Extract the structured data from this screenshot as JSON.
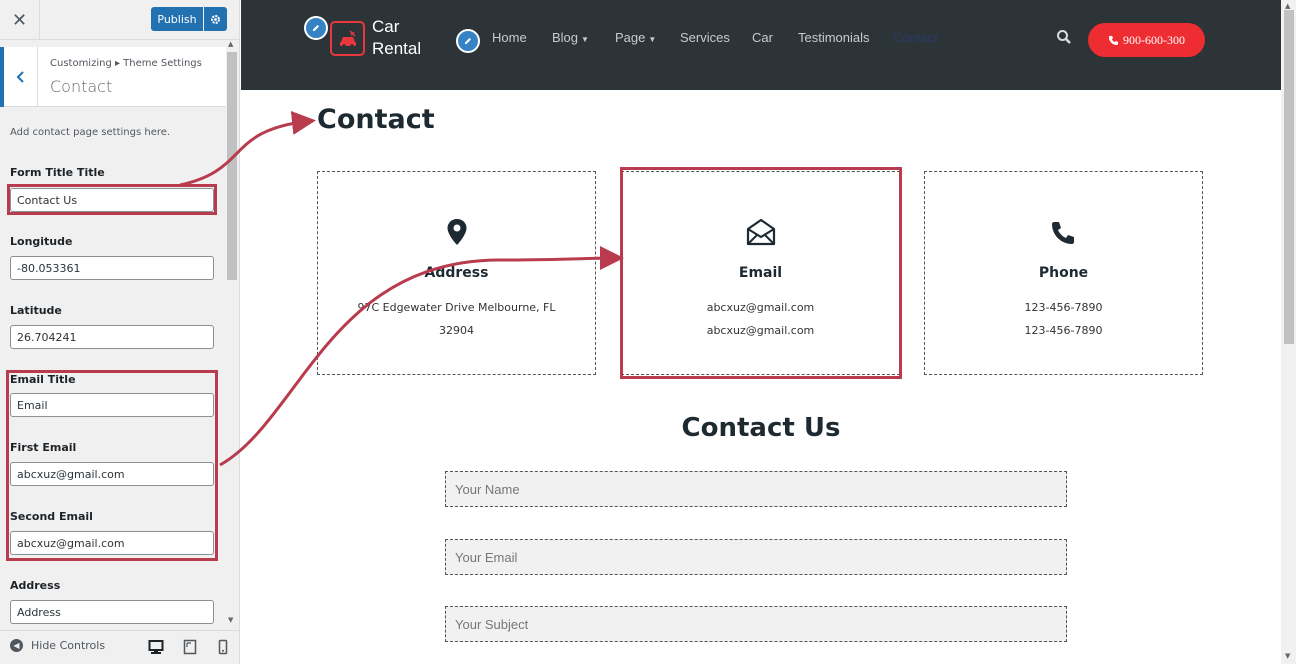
{
  "customizer": {
    "close_label": "✕",
    "publish_label": "Publish",
    "breadcrumb": "Customizing ▸ Theme Settings",
    "section_title": "Contact",
    "description": "Add contact page settings here.",
    "fields": {
      "form_title": {
        "label": "Form Title Title",
        "value": "Contact Us"
      },
      "longitude": {
        "label": "Longitude",
        "value": "-80.053361"
      },
      "latitude": {
        "label": "Latitude",
        "value": "26.704241"
      },
      "email_title": {
        "label": "Email Title",
        "value": "Email"
      },
      "first_email": {
        "label": "First Email",
        "value": "abcxuz@gmail.com"
      },
      "second_email": {
        "label": "Second Email",
        "value": "abcxuz@gmail.com"
      },
      "address": {
        "label": "Address",
        "value": "Address"
      }
    },
    "hide_controls_label": "Hide Controls"
  },
  "site": {
    "logo_line1": "Car",
    "logo_line2": "Rental",
    "nav": {
      "home": "Home",
      "blog": "Blog",
      "page": "Page",
      "services": "Services",
      "car": "Car",
      "testimonials": "Testimonials",
      "contact": "Contact"
    },
    "phone_button": "900-600-300",
    "page_title": "Contact",
    "cards": {
      "address": {
        "title": "Address",
        "line1": "97C Edgewater Drive Melbourne, FL",
        "line2": "32904"
      },
      "email": {
        "title": "Email",
        "line1": "abcxuz@gmail.com",
        "line2": "abcxuz@gmail.com"
      },
      "phone": {
        "title": "Phone",
        "line1": "123-456-7890",
        "line2": "123-456-7890"
      }
    },
    "form_title": "Contact Us",
    "form": {
      "name_placeholder": "Your Name",
      "email_placeholder": "Your Email",
      "subject_placeholder": "Your Subject"
    }
  },
  "colors": {
    "accent_blue": "#2271b1",
    "highlight_red": "#b83c4e",
    "header_dark": "#2c3438",
    "phone_red": "#ee2d33"
  }
}
